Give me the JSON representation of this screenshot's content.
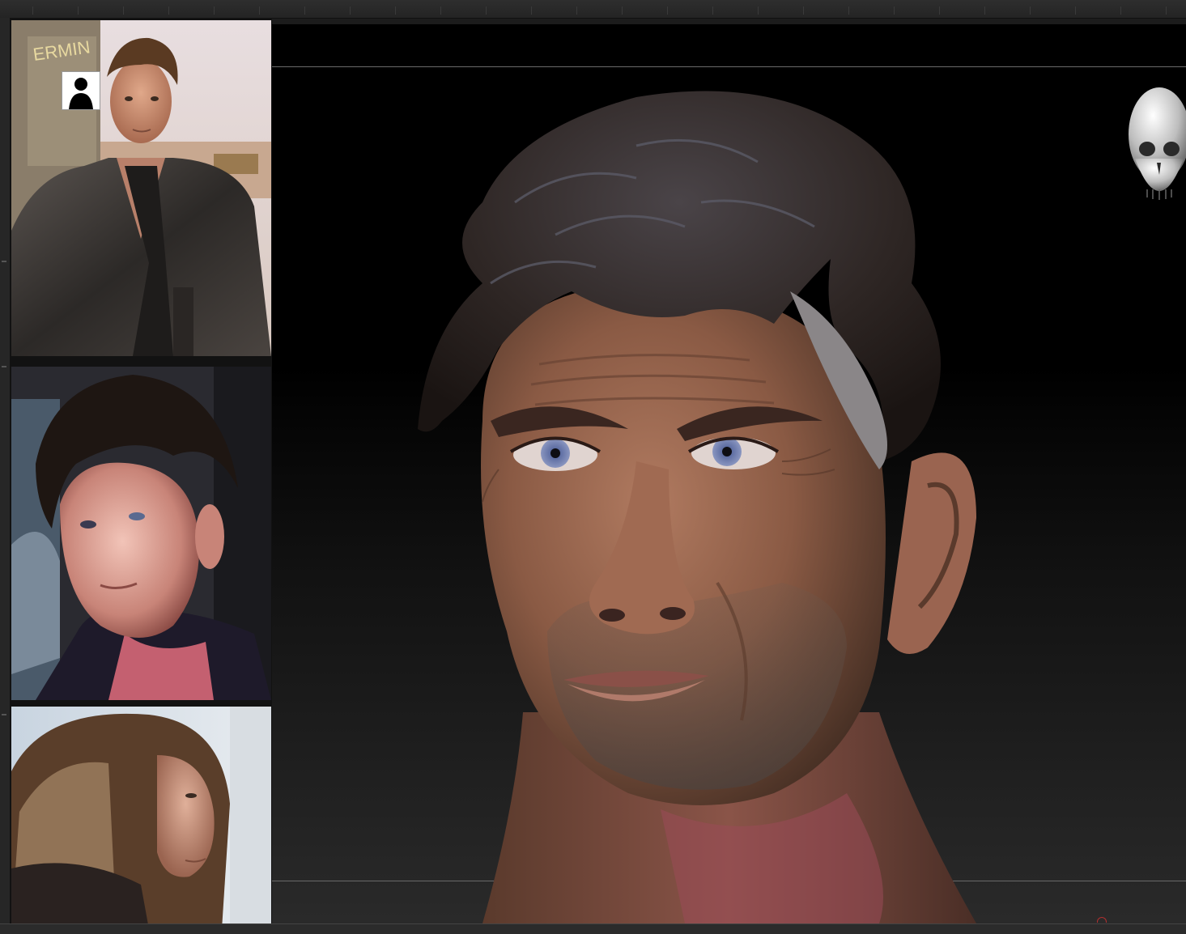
{
  "app": {
    "accent": "#6a6a6a",
    "background": "#000000"
  },
  "references": {
    "items": [
      {
        "label": "reference-photo-1",
        "badge_icon": "silhouette-icon"
      },
      {
        "label": "reference-photo-2"
      },
      {
        "label": "reference-photo-3"
      }
    ],
    "ref1_sign_text": "ERMIN"
  },
  "viewport": {
    "model": "sculpted-head",
    "navigation_widget": "skull-icon"
  }
}
